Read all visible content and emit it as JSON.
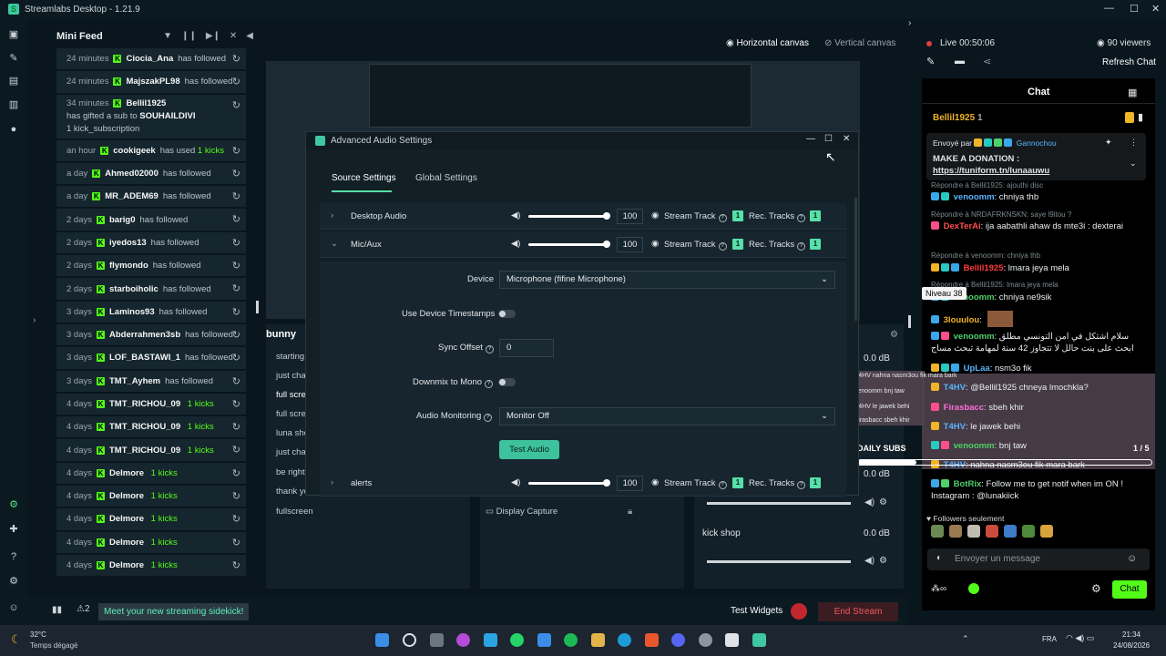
{
  "window": {
    "title": "Streamlabs Desktop - 1.21.9"
  },
  "minifeed": {
    "title": "Mini Feed",
    "items": [
      {
        "time": "24 minutes",
        "name": "Ciocia_Ana",
        "action": "has followed"
      },
      {
        "time": "24 minutes",
        "name": "MajszakPL98",
        "action": "has followed"
      },
      {
        "time": "34 minutes",
        "name": "Bellil1925",
        "action": "has gifted a sub to",
        "target": "SOUHAILDIVI",
        "extra": "1 kick_subscription"
      },
      {
        "time": "an hour",
        "name": "cookigeek",
        "action": "has used",
        "kicks": "1 kicks"
      },
      {
        "time": "a day",
        "name": "Ahmed02000",
        "action": "has followed"
      },
      {
        "time": "a day",
        "name": "MR_ADEM69",
        "action": "has followed"
      },
      {
        "time": "2 days",
        "name": "barig0",
        "action": "has followed"
      },
      {
        "time": "2 days",
        "name": "iyedos13",
        "action": "has followed"
      },
      {
        "time": "2 days",
        "name": "flymondo",
        "action": "has followed"
      },
      {
        "time": "2 days",
        "name": "starboiholic",
        "action": "has followed"
      },
      {
        "time": "3 days",
        "name": "Laminos93",
        "action": "has followed"
      },
      {
        "time": "3 days",
        "name": "Abderrahmen3sb",
        "action": "has followed"
      },
      {
        "time": "3 days",
        "name": "LOF_BASTAWI_1",
        "action": "has followed"
      },
      {
        "time": "3 days",
        "name": "TMT_Ayhem",
        "action": "has followed"
      },
      {
        "time": "4 days",
        "name": "TMT_RICHOU_09",
        "kicks": "1 kicks"
      },
      {
        "time": "4 days",
        "name": "TMT_RICHOU_09",
        "kicks": "1 kicks"
      },
      {
        "time": "4 days",
        "name": "TMT_RICHOU_09",
        "kicks": "1 kicks"
      },
      {
        "time": "4 days",
        "name": "Delmore",
        "kicks": "1 kicks"
      },
      {
        "time": "4 days",
        "name": "Delmore",
        "kicks": "1 kicks"
      },
      {
        "time": "4 days",
        "name": "Delmore",
        "kicks": "1 kicks"
      },
      {
        "time": "4 days",
        "name": "Delmore",
        "kicks": "1 kicks"
      },
      {
        "time": "4 days",
        "name": "Delmore",
        "kicks": "1 kicks"
      }
    ]
  },
  "canvas": {
    "horizontal": "Horizontal canvas",
    "vertical": "Vertical canvas"
  },
  "scenes": {
    "title": "bunny",
    "items": [
      "starting",
      "just cha",
      "full scre",
      "full scre",
      "luna sho",
      "just cha",
      "be right",
      "thank yo",
      "fullscreen"
    ]
  },
  "sources": {
    "item": "Display Capture"
  },
  "mixer": {
    "values": [
      "0.0 dB",
      "0.0 dB",
      "0.0 dB",
      "0.0 dB",
      "0.0 dB"
    ],
    "kickshop": "kick shop"
  },
  "daily": {
    "label": "DAILY SUBS",
    "count": "1 / 5"
  },
  "bottom": {
    "sidekick": "Meet your new streaming sidekick!",
    "badge": "2",
    "test": "Test Widgets",
    "end": "End Stream"
  },
  "live": {
    "status": "Live 00:50:06",
    "viewers": "90 viewers",
    "refresh": "Refresh Chat"
  },
  "chat": {
    "title": "Chat",
    "user": "Bellil1925",
    "count": "1",
    "pinned": {
      "by": "Envoyé par",
      "name": "Gannochou",
      "line1": "MAKE A DONATION :",
      "line2": "https://tuniform.tn/lunaauwu"
    },
    "reply1": "Répondre à Bellil1925: ajouthi disc",
    "m1": {
      "name": "venoomm",
      "text": ": chniya thb"
    },
    "reply2": "Répondre à NRDAFRKNSKN: saye l9itou ?",
    "m2": {
      "name": "DexTerAi",
      "text": ": ija aabathli ahaw ds mte3i : dexterai"
    },
    "reply3": "Répondre à venoomm: chniya thb",
    "m3": {
      "name": "Bellil1925",
      "text": ": lmara jeya mela"
    },
    "reply4": "Répondre à Bellil1925: lmara jeya mela",
    "tooltip": "Niveau 38",
    "m4": {
      "name": "venoomm",
      "text": ": chniya ne9sik"
    },
    "m5": {
      "name": "3louulou",
      "text": ":"
    },
    "m6": {
      "name": "venoomm",
      "text": ": سلام اشتكل في امن التونسي مطلق ابحث على بنت حالل لا تتجاوز 42 سنة لمهامة تبحث مساج"
    },
    "m7": {
      "name": "UpLaa",
      "text": ": nsm3o fik"
    },
    "m8": {
      "name": "T4HV",
      "text": ": @Bellil1925 chneya lmochkla?"
    },
    "m9": {
      "name": "Firasbacc",
      "text": ": sbeh khir"
    },
    "m10": {
      "name": "T4HV",
      "text": ": le jawek behi"
    },
    "m11": {
      "name": "venoomm",
      "text": ": bnj taw"
    },
    "m12": {
      "name": "T4HV",
      "text": ": nahna nasm3ou fik mara bark"
    },
    "m13": {
      "name": "BotRix",
      "text": ": Follow me to get notif when im ON ! Instagram : @lunakiick"
    },
    "overlay": [
      "T4HV nahna nasm3ou fik mara bark",
      "venoomm bnj taw",
      "T4HV le jawek behi",
      "Firasbacc sbeh khir"
    ],
    "followers": "Followers seulement",
    "placeholder": "Envoyer un message",
    "send": "Chat"
  },
  "dialog": {
    "title": "Advanced Audio Settings",
    "tab1": "Source Settings",
    "tab2": "Global Settings",
    "rows": [
      {
        "name": "Desktop Audio",
        "vol": "100"
      },
      {
        "name": "Mic/Aux",
        "vol": "100"
      },
      {
        "name": "alerts",
        "vol": "100"
      }
    ],
    "stream_track": "Stream Track",
    "rec_tracks": "Rec. Tracks",
    "track_num": "1",
    "device_label": "Device",
    "device_value": "Microphone (fifine Microphone)",
    "timestamps": "Use Device Timestamps",
    "sync_label": "Sync Offset",
    "sync_value": "0",
    "downmix": "Downmix to Mono",
    "monitoring_label": "Audio Monitoring",
    "monitoring_value": "Monitor Off",
    "test": "Test Audio"
  },
  "taskbar": {
    "temp": "32°C",
    "weather": "Temps dégagé",
    "lang": "FRA",
    "time": "21:34",
    "date": "24/08/2026"
  }
}
